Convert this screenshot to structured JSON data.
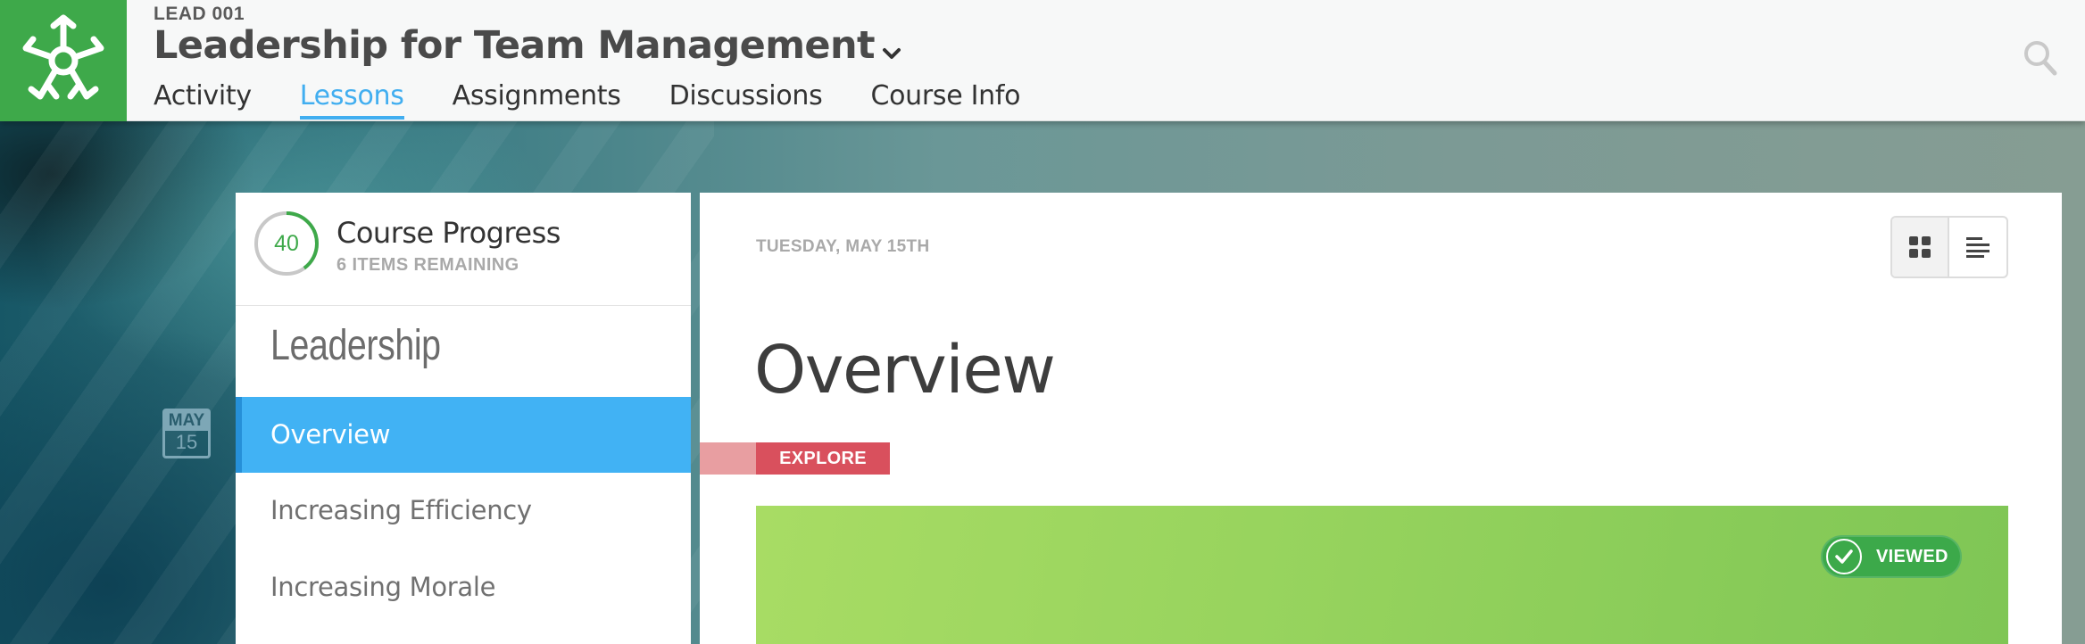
{
  "header": {
    "course_code": "LEAD 001",
    "course_title": "Leadership for Team Management",
    "nav_tabs": [
      {
        "label": "Activity",
        "active": false
      },
      {
        "label": "Lessons",
        "active": true
      },
      {
        "label": "Assignments",
        "active": false
      },
      {
        "label": "Discussions",
        "active": false
      },
      {
        "label": "Course Info",
        "active": false
      }
    ]
  },
  "date_badge": {
    "month": "MAY",
    "day": "15"
  },
  "sidebar": {
    "progress": {
      "value": "40",
      "label": "Course Progress",
      "remaining": "6 ITEMS REMAINING",
      "fraction": 0.4
    },
    "section_title": "Leadership",
    "lessons": [
      {
        "label": "Overview",
        "active": true
      },
      {
        "label": "Increasing Efficiency",
        "active": false
      },
      {
        "label": "Increasing Morale",
        "active": false
      }
    ]
  },
  "main": {
    "date": "TUESDAY, MAY 15TH",
    "title": "Overview",
    "tag": "EXPLORE",
    "status": "VIEWED"
  },
  "colors": {
    "brand_green": "#3ea94a",
    "accent_blue": "#41b2f4",
    "tag_red": "#d9505d"
  },
  "icons": [
    "logo-star-icon",
    "chevron-down-icon",
    "search-icon",
    "grid-view-icon",
    "list-view-icon",
    "check-icon"
  ]
}
